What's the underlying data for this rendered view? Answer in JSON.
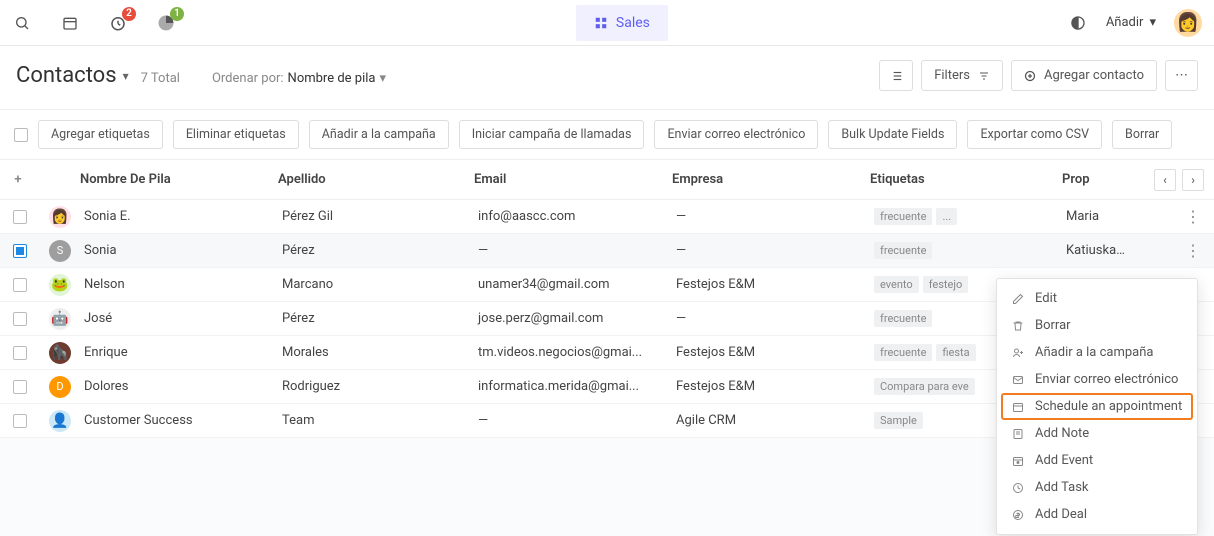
{
  "topbar": {
    "badge_clock": "2",
    "badge_chart": "1",
    "sales_label": "Sales",
    "add_label": "Añadir"
  },
  "subbar": {
    "title": "Contactos",
    "total": "7 Total",
    "sort_label": "Ordenar por:",
    "sort_value": "Nombre de pila",
    "filters_label": "Filters",
    "add_contact_label": "Agregar contacto"
  },
  "bulk_actions": [
    "Agregar etiquetas",
    "Eliminar etiquetas",
    "Añadir a la campaña",
    "Iniciar campaña de llamadas",
    "Enviar correo electrónico",
    "Bulk Update Fields",
    "Exportar como CSV",
    "Borrar"
  ],
  "columns": {
    "name": "Nombre De Pila",
    "last": "Apellido",
    "email": "Email",
    "company": "Empresa",
    "tags": "Etiquetas",
    "owner": "Prop"
  },
  "rows": [
    {
      "selected": false,
      "av_bg": "#ffe0e6",
      "av_txt": "👩",
      "name": "Sonia E.",
      "last": "Pérez Gil",
      "email": "info@aascc.com",
      "company": "—",
      "tags": [
        "frecuente",
        "..."
      ],
      "owner": "Maria",
      "menu": true
    },
    {
      "selected": true,
      "av_bg": "#9e9e9e",
      "av_txt": "S",
      "av_color": "#fff",
      "name": "Sonia",
      "last": "Pérez",
      "email": "—",
      "company": "—",
      "tags": [
        "frecuente"
      ],
      "owner": "Katiuska Gu",
      "menu": true
    },
    {
      "selected": false,
      "av_bg": "#dff5d6",
      "av_txt": "🐸",
      "name": "Nelson",
      "last": "Marcano",
      "email": "unamer34@gmail.com",
      "company": "Festejos E&M",
      "tags": [
        "evento",
        "festejo"
      ],
      "owner": "",
      "menu": false
    },
    {
      "selected": false,
      "av_bg": "#eee",
      "av_txt": "🤖",
      "name": "José",
      "last": "Pérez",
      "email": "jose.perz@gmail.com",
      "company": "—",
      "tags": [
        "frecuente"
      ],
      "owner": "",
      "menu": false
    },
    {
      "selected": false,
      "av_bg": "#6d3b2f",
      "av_txt": "🦍",
      "name": "Enrique",
      "last": "Morales",
      "email": "tm.videos.negocios@gmai...",
      "company": "Festejos E&M",
      "tags": [
        "frecuente",
        "fiesta"
      ],
      "owner": "",
      "menu": false
    },
    {
      "selected": false,
      "av_bg": "#ff9800",
      "av_txt": "D",
      "av_color": "#fff",
      "name": "Dolores",
      "last": "Rodriguez",
      "email": "informatica.merida@gmai...",
      "company": "Festejos E&M",
      "tags": [
        "Compara para eve"
      ],
      "owner": "",
      "menu": false
    },
    {
      "selected": false,
      "av_bg": "#cce7f5",
      "av_txt": "👤",
      "name": "Customer Success",
      "last": "Team",
      "email": "—",
      "company": "Agile CRM",
      "tags": [
        "Sample"
      ],
      "owner": "",
      "menu": false
    }
  ],
  "context_menu": [
    {
      "icon": "edit",
      "label": "Edit"
    },
    {
      "icon": "trash",
      "label": "Borrar"
    },
    {
      "icon": "user-plus",
      "label": "Añadir a la campaña"
    },
    {
      "icon": "mail",
      "label": "Enviar correo electrónico"
    },
    {
      "icon": "calendar",
      "label": "Schedule an appointment",
      "highlight": true
    },
    {
      "icon": "note",
      "label": "Add Note"
    },
    {
      "icon": "event",
      "label": "Add Event"
    },
    {
      "icon": "clock",
      "label": "Add Task"
    },
    {
      "icon": "deal",
      "label": "Add Deal"
    }
  ]
}
